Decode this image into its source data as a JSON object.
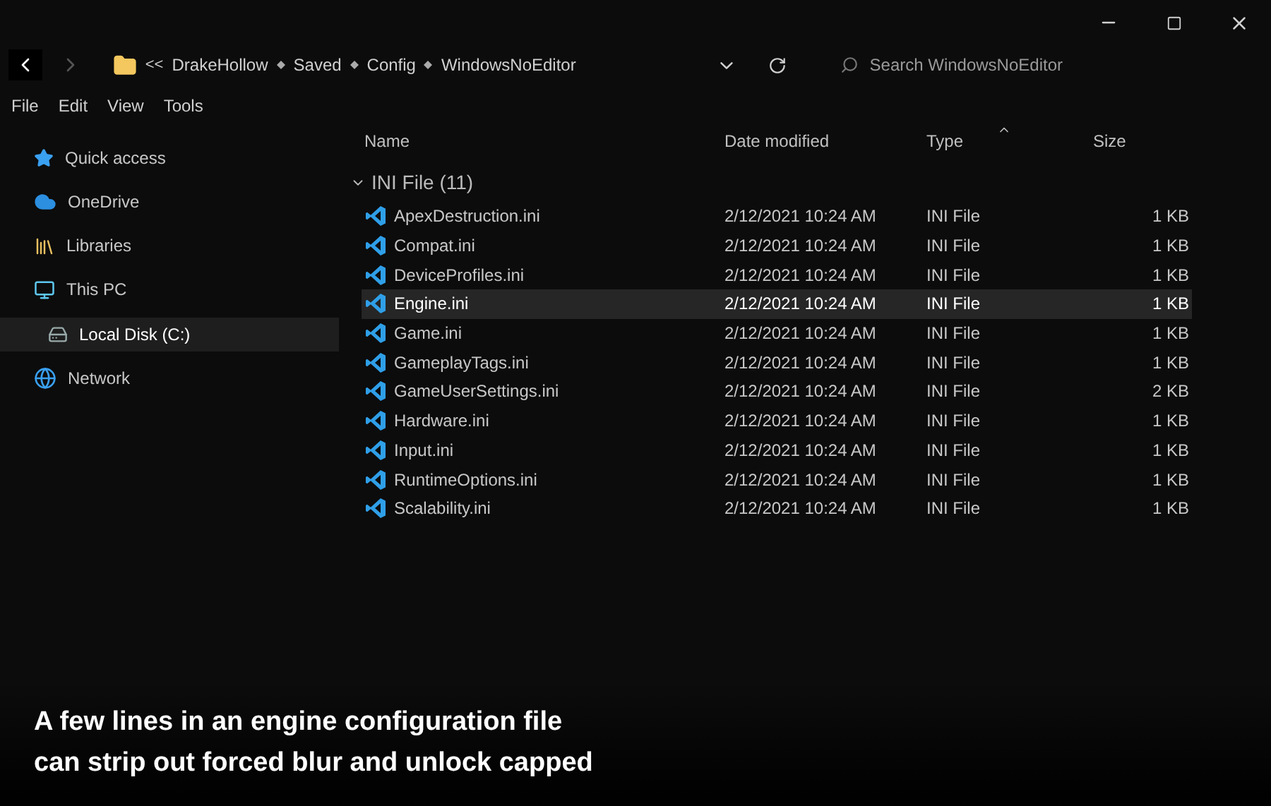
{
  "address": {
    "segments": [
      "DrakeHollow",
      "Saved",
      "Config",
      "WindowsNoEditor"
    ],
    "overflow": "<<"
  },
  "search": {
    "placeholder": "Search WindowsNoEditor"
  },
  "menu": [
    "File",
    "Edit",
    "View",
    "Tools"
  ],
  "sidebar": {
    "items": [
      {
        "label": "Quick access",
        "kind": "star",
        "selected": false
      },
      {
        "label": "OneDrive",
        "kind": "cloud",
        "selected": false
      },
      {
        "label": "Libraries",
        "kind": "library",
        "selected": false
      },
      {
        "label": "This PC",
        "kind": "pc",
        "selected": false,
        "children": [
          {
            "label": "Local Disk (C:)",
            "kind": "disk",
            "selected": true
          }
        ]
      },
      {
        "label": "Network",
        "kind": "network",
        "selected": false
      }
    ]
  },
  "table": {
    "columns": [
      "Name",
      "Date modified",
      "Type",
      "Size"
    ],
    "group": {
      "label": "INI File (11)",
      "expanded": true
    },
    "rows": [
      {
        "name": "ApexDestruction.ini",
        "date": "2/12/2021 10:24 AM",
        "type": "INI File",
        "size": "1 KB",
        "selected": false
      },
      {
        "name": "Compat.ini",
        "date": "2/12/2021 10:24 AM",
        "type": "INI File",
        "size": "1 KB",
        "selected": false
      },
      {
        "name": "DeviceProfiles.ini",
        "date": "2/12/2021 10:24 AM",
        "type": "INI File",
        "size": "1 KB",
        "selected": false
      },
      {
        "name": "Engine.ini",
        "date": "2/12/2021 10:24 AM",
        "type": "INI File",
        "size": "1 KB",
        "selected": true
      },
      {
        "name": "Game.ini",
        "date": "2/12/2021 10:24 AM",
        "type": "INI File",
        "size": "1 KB",
        "selected": false
      },
      {
        "name": "GameplayTags.ini",
        "date": "2/12/2021 10:24 AM",
        "type": "INI File",
        "size": "1 KB",
        "selected": false
      },
      {
        "name": "GameUserSettings.ini",
        "date": "2/12/2021 10:24 AM",
        "type": "INI File",
        "size": "2 KB",
        "selected": false
      },
      {
        "name": "Hardware.ini",
        "date": "2/12/2021 10:24 AM",
        "type": "INI File",
        "size": "1 KB",
        "selected": false
      },
      {
        "name": "Input.ini",
        "date": "2/12/2021 10:24 AM",
        "type": "INI File",
        "size": "1 KB",
        "selected": false
      },
      {
        "name": "RuntimeOptions.ini",
        "date": "2/12/2021 10:24 AM",
        "type": "INI File",
        "size": "1 KB",
        "selected": false
      },
      {
        "name": "Scalability.ini",
        "date": "2/12/2021 10:24 AM",
        "type": "INI File",
        "size": "1 KB",
        "selected": false
      }
    ]
  },
  "caption": {
    "lines": [
      "A few lines in an engine configuration file",
      "can strip out forced blur and unlock capped"
    ]
  }
}
